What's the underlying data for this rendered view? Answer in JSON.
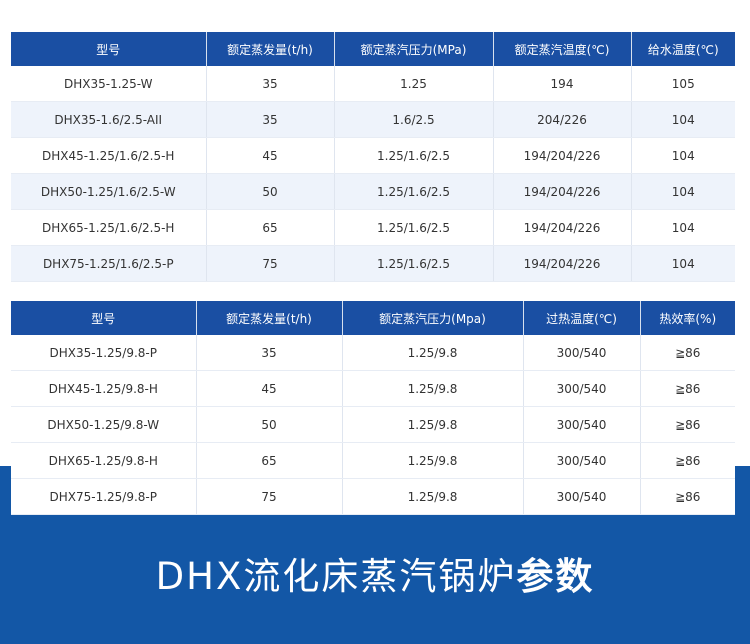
{
  "table1": {
    "headers": [
      "型号",
      "额定蒸发量(t/h)",
      "额定蒸汽压力(MPa)",
      "额定蒸汽温度(℃)",
      "给水温度(℃)"
    ],
    "rows": [
      [
        "DHX35-1.25-W",
        "35",
        "1.25",
        "194",
        "105"
      ],
      [
        "DHX35-1.6/2.5-AII",
        "35",
        "1.6/2.5",
        "204/226",
        "104"
      ],
      [
        "DHX45-1.25/1.6/2.5-H",
        "45",
        "1.25/1.6/2.5",
        "194/204/226",
        "104"
      ],
      [
        "DHX50-1.25/1.6/2.5-W",
        "50",
        "1.25/1.6/2.5",
        "194/204/226",
        "104"
      ],
      [
        "DHX65-1.25/1.6/2.5-H",
        "65",
        "1.25/1.6/2.5",
        "194/204/226",
        "104"
      ],
      [
        "DHX75-1.25/1.6/2.5-P",
        "75",
        "1.25/1.6/2.5",
        "194/204/226",
        "104"
      ]
    ]
  },
  "table2": {
    "headers": [
      "型号",
      "额定蒸发量(t/h)",
      "额定蒸汽压力(Mpa)",
      "过热温度(℃)",
      "热效率(%)"
    ],
    "rows": [
      [
        "DHX35-1.25/9.8-P",
        "35",
        "1.25/9.8",
        "300/540",
        "≧86"
      ],
      [
        "DHX45-1.25/9.8-H",
        "45",
        "1.25/9.8",
        "300/540",
        "≧86"
      ],
      [
        "DHX50-1.25/9.8-W",
        "50",
        "1.25/9.8",
        "300/540",
        "≧86"
      ],
      [
        "DHX65-1.25/9.8-H",
        "65",
        "1.25/9.8",
        "300/540",
        "≧86"
      ],
      [
        "DHX75-1.25/9.8-P",
        "75",
        "1.25/9.8",
        "300/540",
        "≧86"
      ]
    ]
  },
  "banner": {
    "title_main": "DHX流化床蒸汽锅炉",
    "title_bold": "参数"
  },
  "colors": {
    "header_bg": "#1a4fa3",
    "band_bg": "#1357a6",
    "stripe": "#eef3fb"
  }
}
